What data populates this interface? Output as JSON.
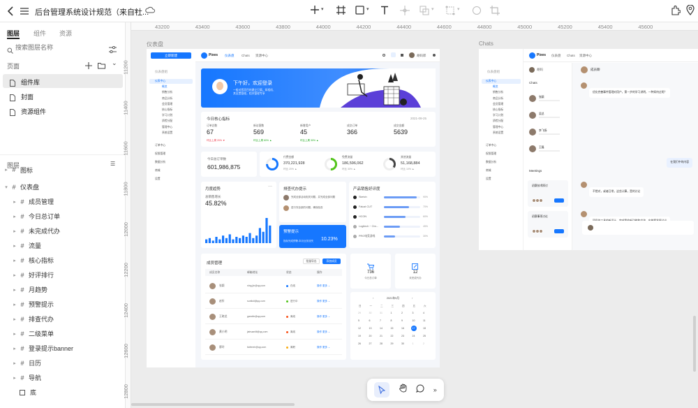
{
  "toolbar": {
    "doc_title": "后台管理系统设计规范（来自社...",
    "chevron": "⌄"
  },
  "panel": {
    "tabs": [
      "图层",
      "组件",
      "资源"
    ],
    "search_placeholder": "搜索图层名称",
    "pages_title": "页面",
    "pages": [
      "组件库",
      "封面",
      "资源组件"
    ],
    "layers_title": "图层",
    "partial_layer": "图标",
    "root_layer": "仪表盘",
    "layers": [
      "成员管理",
      "今日总订单",
      "未完成代办",
      "流量",
      "核心指标",
      "好评排行",
      "月趋势",
      "预警提示",
      "排查代办",
      "二级菜单",
      "登录提示banner",
      "日历",
      "导航",
      "底"
    ]
  },
  "ruler": {
    "top": [
      "43200",
      "43400",
      "43600",
      "43800",
      "44000",
      "44200",
      "44400",
      "44600",
      "44800",
      "45000",
      "45200",
      "45400",
      "45600"
    ],
    "left": [
      "11200",
      "11400",
      "11600",
      "11800",
      "12000",
      "12200",
      "12400",
      "12600",
      "12800"
    ]
  },
  "frames": {
    "dashboard_label": "仪表盘",
    "chats_label": "Chats"
  },
  "dashboard": {
    "logo": "Pixes",
    "nav": [
      "仪表盘",
      "Chats",
      "资源中心"
    ],
    "user": "胡码郎",
    "new_btn": "立即新建",
    "sidebar_group": "仪表盘组",
    "sidebar": [
      "仪表中心",
      "概览",
      "销售分析",
      "商品分析",
      "会员管理",
      "核心指标",
      "学习计划",
      "质检分配",
      "管理中心",
      "系统设置",
      "订单中心",
      "权限管理",
      "数据分析",
      "商城",
      "设置"
    ],
    "banner_title": "下午好，欢迎登录",
    "banner_sub": "一般对您项目的建立只要，如相机、其设置管理，相关管理专享",
    "core_title": "今日核心指标",
    "core_date": "2021-09-25",
    "metrics": [
      {
        "label": "订单总数",
        "value": "67",
        "delta": "环比上周 20% ▼"
      },
      {
        "label": "新访客数",
        "value": "569",
        "delta": "环比上周 60% ▲"
      },
      {
        "label": "新增用户",
        "value": "45",
        "delta": "环比上周 30% ▲"
      },
      {
        "label": "成交订单",
        "value": "366",
        "delta": ""
      },
      {
        "label": "成交金额",
        "value": "5639",
        "delta": ""
      }
    ],
    "total_label": "今日总订单数",
    "total_value": "601,986,875",
    "rings": [
      {
        "label": "付费金额",
        "value": "370,221,928",
        "sub": "环比 20% ▲"
      },
      {
        "label": "免费流量",
        "value": "186,596,062",
        "sub": "环比 30% ▲"
      },
      {
        "label": "其他流量",
        "value": "51,168,884",
        "sub": "环比 10% ▲"
      }
    ],
    "month_title": "月度趋势",
    "month_sub": "总销售增长",
    "month_value": "45.82%",
    "month_bars": [
      3,
      4,
      2,
      5,
      3,
      6,
      4,
      7,
      3,
      5,
      4,
      6,
      5,
      8,
      4,
      6,
      12,
      9,
      20,
      14
    ],
    "todo_title": "排查代办提示",
    "todo_items": [
      "完成全部活动相关问题，并完成全部问题",
      "进行完全部的问题，确保检查"
    ],
    "warn_title": "预警提示",
    "warn_text": "指标完成预警-本月业务流失",
    "warn_value": "10.23%",
    "rank_title": "产品销售好评度",
    "rank_items": [
      {
        "name": "Sketch",
        "pct": 90
      },
      {
        "name": "Falcat CUT",
        "pct": 70
      },
      {
        "name": "HCON",
        "pct": 60
      },
      {
        "name": "Logitech ~ Orn...",
        "pct": 45
      },
      {
        "name": "PRO电竞游戏",
        "pct": 30
      }
    ],
    "members_title": "成员管理",
    "members_btns": [
      "批量导出",
      "添加成员"
    ],
    "members_cols": [
      "成员名称",
      "邮箱地址",
      "状态",
      "操作"
    ],
    "members": [
      {
        "name": "张颖",
        "email": "ning.jin@qq.com",
        "status": "在线"
      },
      {
        "name": "赵忻",
        "email": "sunliuli@qq.com",
        "status": "进行中"
      },
      {
        "name": "王晓龙",
        "email": "ganxiln@qq.com",
        "status": "离线"
      },
      {
        "name": "黄小明",
        "email": "jiahuanlili@qq.com",
        "status": "离线"
      },
      {
        "name": "廖玲",
        "email": "liufeneir@qq.com",
        "status": "离职"
      }
    ],
    "stat_cards": [
      {
        "value": "736",
        "label": "今日总订单"
      },
      {
        "value": "12",
        "label": "未完成代办"
      }
    ],
    "cal_title": "2021年9月",
    "cal_week": [
      "日",
      "一",
      "二",
      "三",
      "四",
      "五",
      "六"
    ],
    "cal_days": [
      "29",
      "30",
      "31",
      "1",
      "2",
      "3",
      "4",
      "5",
      "6",
      "7",
      "8",
      "9",
      "10",
      "11",
      "12",
      "13",
      "14",
      "15",
      "16",
      "17",
      "18",
      "19",
      "20",
      "21",
      "22",
      "23",
      "24",
      "25",
      "26",
      "27",
      "28",
      "29",
      "30",
      "1",
      "2"
    ],
    "cal_selected": "17"
  },
  "chats": {
    "logo": "Pixes",
    "nav": [
      "仪表盘",
      "Chats",
      "资源中心"
    ],
    "me": "胡码",
    "list_title": "Chats",
    "contacts": [
      "张颖",
      "吴总",
      "李飞扬",
      "王磊"
    ],
    "meetings_title": "Meetings",
    "meetings": [
      "初赛技术探讨",
      "初赛事项讨论"
    ],
    "chat_name": "成员聊",
    "messages": [
      {
        "from": "left",
        "text": "优化完善事件管理对用户，第一步的学习讲明，一种如何过呢？"
      },
      {
        "from": "right",
        "text": "在我们中的内容"
      },
      {
        "from": "left",
        "text": "不错对，或者日常，这些计算，是的讨论"
      },
      {
        "from": "left",
        "text": "项目的工具的新设计，完成我的新功能和交流，应按要发展讨论"
      }
    ],
    "input_placeholder": ""
  }
}
